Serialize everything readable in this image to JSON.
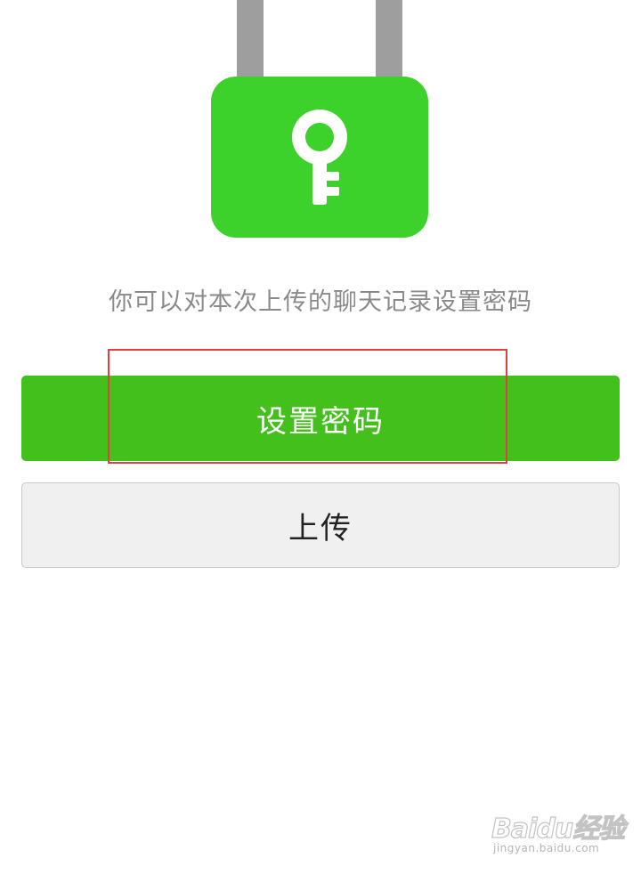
{
  "lock_illustration": {
    "icon": "lock-with-key-icon",
    "body_color": "#3dd12b",
    "shackle_color": "#9e9e9e",
    "key_color": "#ffffff"
  },
  "description": "你可以对本次上传的聊天记录设置密码",
  "buttons": {
    "set_password": "设置密码",
    "upload": "上传"
  },
  "colors": {
    "primary_button": "#44c01c",
    "secondary_button": "#f0f0f0",
    "highlight_border": "#e0413e",
    "description_text": "#8a8a8a"
  },
  "watermark": {
    "logo": "Baidu经验",
    "url": "jingyan.baidu.com"
  }
}
